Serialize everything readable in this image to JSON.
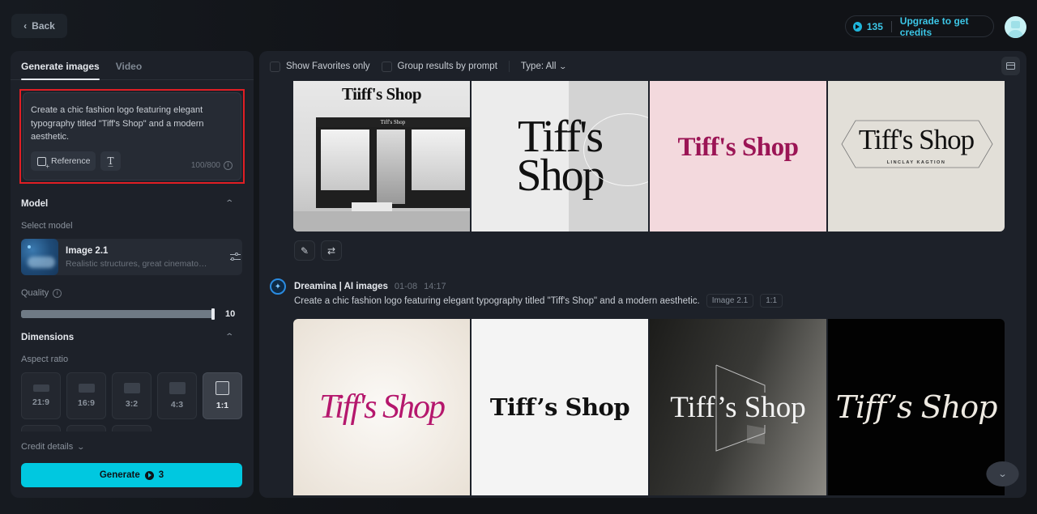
{
  "header": {
    "back_label": "Back",
    "credits": "135",
    "upgrade_label": "Upgrade to get credits",
    "avatar_icon": "user-avatar-icon"
  },
  "left_panel": {
    "tabs": [
      {
        "label": "Generate images",
        "active": true
      },
      {
        "label": "Video",
        "active": false
      }
    ],
    "prompt": {
      "value": "Create a chic fashion logo featuring elegant typography titled \"Tiff's Shop\" and a modern aesthetic.",
      "reference_label": "Reference",
      "char_count": "100/800"
    },
    "model": {
      "section_title": "Model",
      "select_label": "Select model",
      "name": "Image 2.1",
      "description": "Realistic structures, great cinematography"
    },
    "quality": {
      "label": "Quality",
      "value": "10",
      "fill_fraction": 1.0
    },
    "dimensions": {
      "section_title": "Dimensions",
      "aspect_label": "Aspect ratio",
      "options": [
        {
          "label": "21:9",
          "selected": false
        },
        {
          "label": "16:9",
          "selected": false
        },
        {
          "label": "3:2",
          "selected": false
        },
        {
          "label": "4:3",
          "selected": false
        },
        {
          "label": "1:1",
          "selected": true
        }
      ]
    },
    "credit_details_label": "Credit details",
    "generate": {
      "label": "Generate",
      "cost": "3",
      "color": "#00c8e0"
    }
  },
  "main": {
    "filters": {
      "favorites_label": "Show Favorites only",
      "group_label": "Group results by prompt",
      "type_label": "Type: All"
    },
    "generation_1": {
      "images": [
        {
          "text": "Tiiff's Shop",
          "subtext": "Tiff's Shop",
          "style": "storefront photo"
        },
        {
          "text": "Tiff's Shop",
          "style": "large serif on grey"
        },
        {
          "text": "Tiff's Shop",
          "style": "magenta serif on pink"
        },
        {
          "text": "Tiff's Shop",
          "subtext": "LINCLAY KAGTION",
          "style": "hexagon badge on beige"
        }
      ]
    },
    "generation_2": {
      "source": "Dreamina | AI images",
      "date": "01-08",
      "time": "14:17",
      "prompt": "Create a chic fashion logo featuring elegant typography titled \"Tiff's Shop\" and a modern aesthetic.",
      "model_tag": "Image 2.1",
      "ratio_tag": "1:1",
      "images": [
        {
          "text": "Tiff's Shop",
          "style": "magenta italic on cream"
        },
        {
          "text": "Tiff’s Shop",
          "style": "bold serif on white"
        },
        {
          "text": "Tiff’s Shop",
          "style": "white serif on dark gradient"
        },
        {
          "text": "Tiff’s Shop",
          "style": "script on black"
        }
      ]
    }
  }
}
